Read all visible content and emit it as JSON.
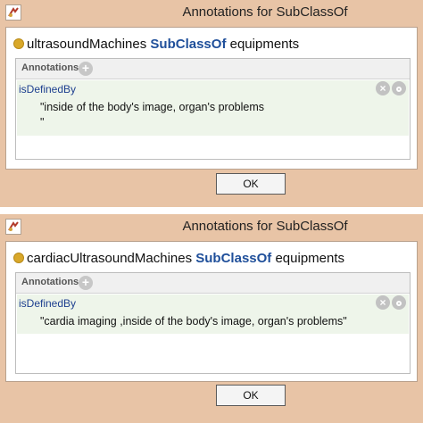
{
  "dialogs": [
    {
      "title": "Annotations for SubClassOf",
      "subject": "ultrasoundMachines",
      "relation": "SubClassOf",
      "object": "equipments",
      "annotations_label": "Annotations",
      "annotation": {
        "property": "isDefinedBy",
        "value": "\"inside of the body's image, organ's problems\n\""
      },
      "ok_label": "OK"
    },
    {
      "title": "Annotations for SubClassOf",
      "subject": "cardiacUltrasoundMachines",
      "relation": "SubClassOf",
      "object": "equipments",
      "annotations_label": "Annotations",
      "annotation": {
        "property": "isDefinedBy",
        "value": "\"cardia imaging ,inside of the body's image, organ's problems\""
      },
      "ok_label": "OK"
    }
  ],
  "icons": {
    "app": "app-window-icon",
    "add": "add-annotation-icon",
    "remove": "remove-annotation-icon",
    "edit": "edit-annotation-icon",
    "class_bullet": "class-bullet-icon"
  },
  "colors": {
    "window_frame": "#e8c4a6",
    "class_bullet": "#d9a82a",
    "keyword": "#1f4f9a",
    "property": "#1d3f8f",
    "annotation_row": "#eef5ea"
  }
}
